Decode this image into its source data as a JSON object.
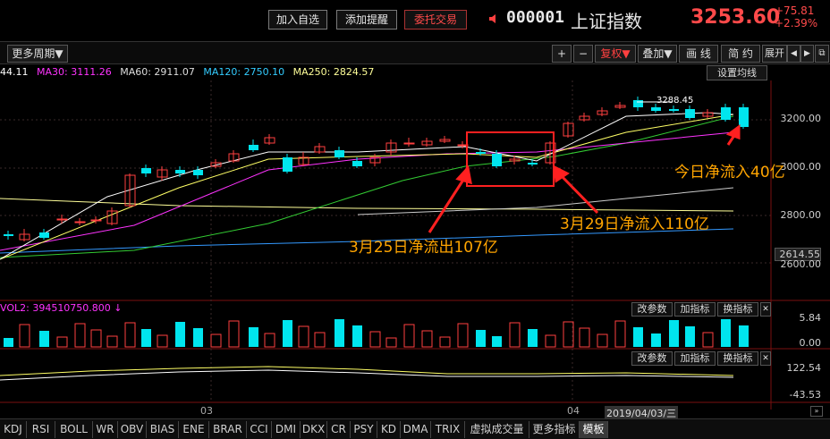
{
  "top": {
    "buttons": [
      "加入自选",
      "添加提醒",
      "委托交易"
    ],
    "code": "000001",
    "name": "上证指数",
    "price": "3253.60",
    "change": "+75.81",
    "change_pct": "+2.39%"
  },
  "toolbar": {
    "period": "更多周期▼",
    "plus": "+",
    "minus": "−",
    "fuquan": "复权▼",
    "overlay": "叠加▼",
    "draw": "画 线",
    "simple": "简 约",
    "expand": "展开",
    "prev": "◀",
    "next": "▶",
    "restore": "⧉"
  },
  "ma": {
    "ma5": "44.11",
    "ma30_label": "MA30: 3111.26",
    "ma60_label": "MA60: 2911.07",
    "ma120_label": "MA120: 2750.10",
    "ma250_label": "MA250: 2824.57",
    "settings": "设置均线"
  },
  "yaxis": {
    "main": [
      "3200.00",
      "3000.00",
      "2800.00",
      "2614.55",
      "2600.00"
    ],
    "vol": [
      "5.84",
      "0.00"
    ],
    "osc": [
      "122.54",
      "-43.53"
    ],
    "high_marker": "3288.45"
  },
  "annotations": {
    "a1": "今日净流入40亿",
    "a2": "3月29日净流入110亿",
    "a3": "3月25日净流出107亿"
  },
  "vol_panel": {
    "label": "VOL2: 394510750.800 ↓",
    "btn_params": "改参数",
    "btn_add": "加指标",
    "btn_swap": "换指标"
  },
  "osc_panel": {
    "btn_params": "改参数",
    "btn_add": "加指标",
    "btn_swap": "换指标"
  },
  "xaxis": {
    "m1": "03",
    "m2": "04",
    "date": "2019/04/03/三"
  },
  "tabs": [
    "KDJ",
    "RSI",
    "BOLL",
    "WR",
    "OBV",
    "BIAS",
    "ENE",
    "BRAR",
    "CCI",
    "DMI",
    "DKX",
    "CR",
    "PSY",
    "KD",
    "DMA",
    "TRIX",
    "虚拟成交量",
    "更多指标",
    "模板"
  ],
  "colors": {
    "up": "#ff4040",
    "down": "#00e5ee",
    "ma5": "#ffffff",
    "ma10": "#ffff66",
    "ma30": "#ff33ff",
    "ma60": "#33cc33",
    "ma120": "#3399ff",
    "ma250": "#ffff99",
    "annotation": "#ffa500"
  }
}
